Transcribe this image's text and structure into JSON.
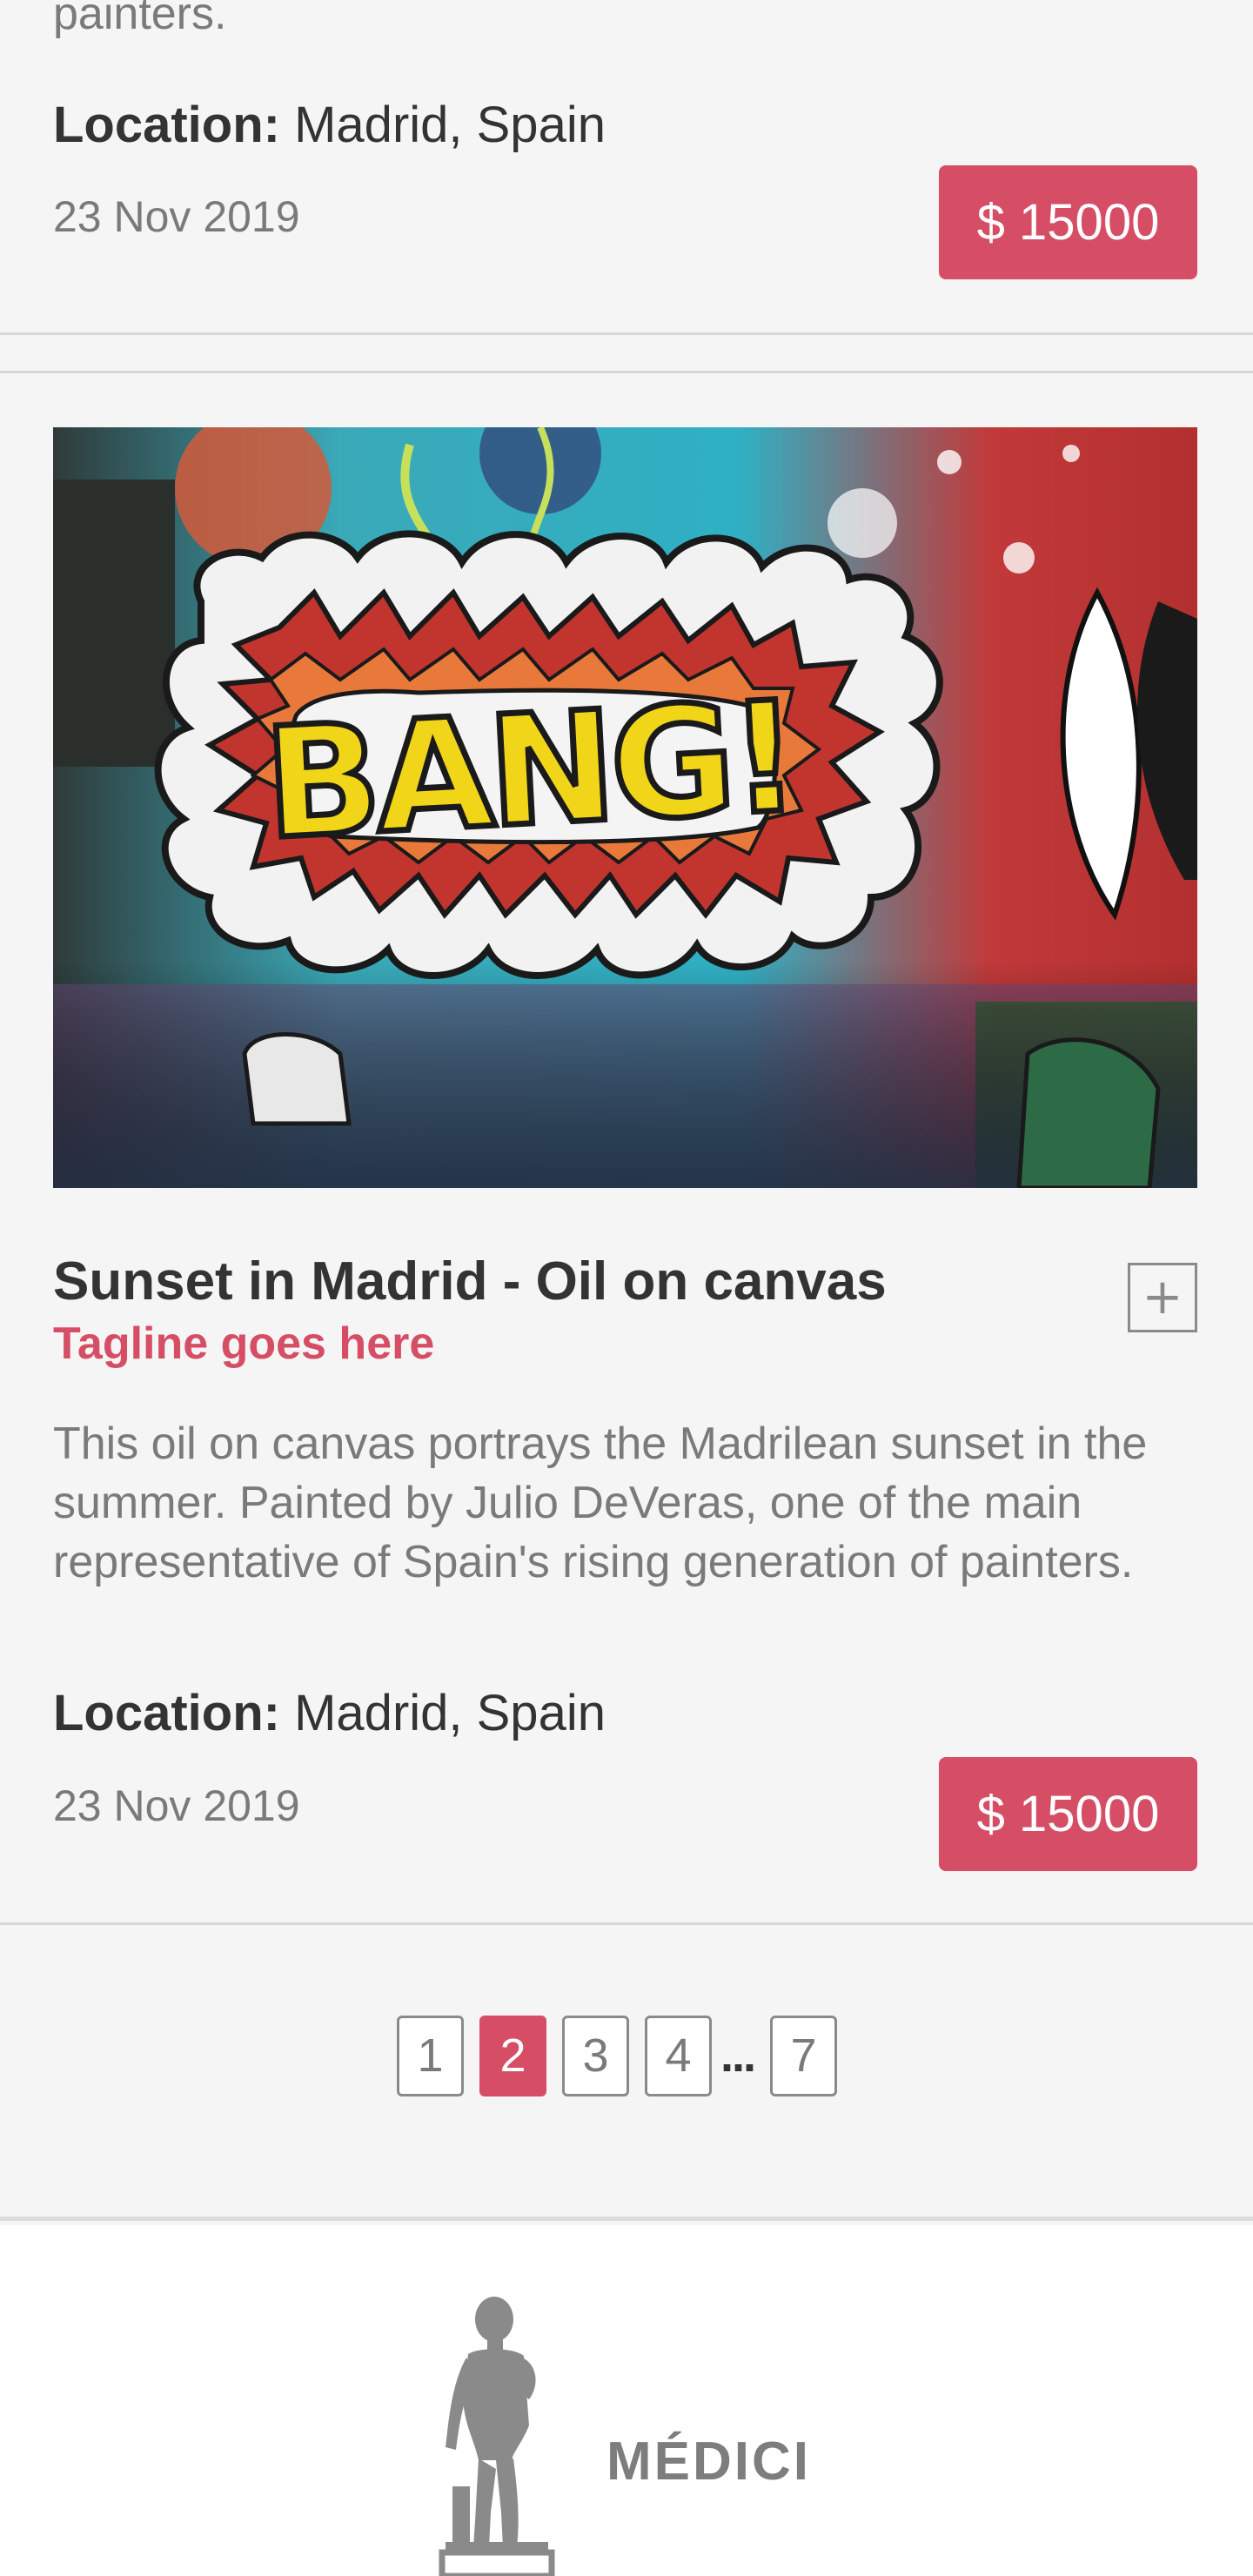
{
  "top_card": {
    "description_tail": "painters.",
    "location_label": "Location:",
    "location_value": "Madrid, Spain",
    "date": "23 Nov 2019",
    "price": "$ 15000"
  },
  "main_card": {
    "image_text": "BANG!",
    "title": "Sunset in Madrid - Oil on canvas",
    "tagline": "Tagline goes here",
    "add_icon": "plus-icon",
    "add_label": "+",
    "description": "This oil on canvas portrays the Madrilean sunset in the summer. Painted by Julio DeVeras, one of the main representative of Spain's rising generation of painters.",
    "location_label": "Location:",
    "location_value": "Madrid, Spain",
    "date": "23 Nov 2019",
    "price": "$ 15000"
  },
  "pagination": {
    "pages": [
      "1",
      "2",
      "3",
      "4"
    ],
    "ellipsis": "...",
    "last_page": "7",
    "current_page": "2"
  },
  "footer": {
    "logo_icon": "statue-icon",
    "brand": "MÉDICI"
  },
  "colors": {
    "accent": "#d64e66",
    "background": "#f5f5f5",
    "text_dark": "#333333",
    "text_muted": "#7a7a7a"
  }
}
